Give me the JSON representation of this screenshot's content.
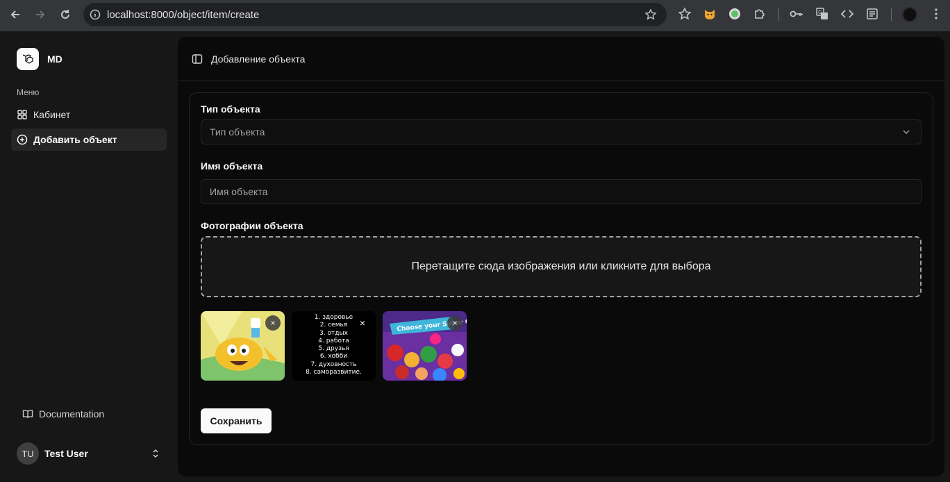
{
  "browser": {
    "url": "localhost:8000/object/item/create",
    "extension_icons": [
      "star-icon",
      "cat-extension-icon",
      "green-dot-extension-icon",
      "puzzle-icon",
      "key-icon",
      "translate-icon",
      "code-icon",
      "reading-list-icon",
      "profile-icon"
    ]
  },
  "sidebar": {
    "brand": "MD",
    "menu_label": "Меню",
    "items": [
      {
        "label": "Кабинет",
        "icon": "grid-icon",
        "active": false
      },
      {
        "label": "Добавить объект",
        "icon": "plus-circle-icon",
        "active": true
      }
    ],
    "documentation_label": "Documentation",
    "user": {
      "initials": "TU",
      "name": "Test User"
    }
  },
  "header": {
    "title": "Добавление объекта"
  },
  "form": {
    "type_label": "Тип объекта",
    "type_placeholder": "Тип объекта",
    "name_label": "Имя объекта",
    "name_placeholder": "Имя объекта",
    "photos_label": "Фотографии объекта",
    "dropzone_text": "Перетащите сюда изображения или кликните для выбора",
    "photos": [
      {
        "kind": "cartoon-adventure-time"
      },
      {
        "kind": "text-list",
        "lines": [
          "1. здоровье",
          "2. семья",
          "3. отдых",
          "4. работа",
          "5. друзья",
          "6. хобби",
          "7. духовность",
          "8. саморазвитие."
        ]
      },
      {
        "kind": "game-choose-your",
        "caption": "Choose your Super C..."
      }
    ],
    "remove_symbol": "×",
    "save_label": "Сохранить"
  }
}
